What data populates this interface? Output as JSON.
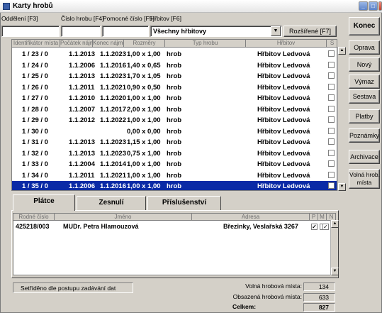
{
  "window": {
    "title": "Karty hrobů"
  },
  "filters": {
    "labels": [
      "Oddělení [F3]",
      "Číslo hrobu [F4]",
      "Pomocné číslo [F5]",
      "Hřbitov [F6]"
    ],
    "cemetery_value": "Všechny hřbitovy",
    "advanced_label": "Rozšířené [F7]"
  },
  "grid": {
    "headers": [
      "Identifikátor místa",
      "Počátek nájmu",
      "Konec nájmu",
      "Rozměry",
      "Typ hrobu",
      "Hřbitov",
      "S"
    ],
    "rows": [
      {
        "id": "1 / 23 / 0",
        "start": "1.1.2013",
        "end": "1.1.2023",
        "size": "1,00 x 1,00",
        "type": "hrob",
        "cemetery": "Hřbitov Ledvová"
      },
      {
        "id": "1 / 24 / 0",
        "start": "1.1.2006",
        "end": "1.1.2016",
        "size": "1,40 x 0,65",
        "type": "hrob",
        "cemetery": "Hřbitov Ledvová"
      },
      {
        "id": "1 / 25 / 0",
        "start": "1.1.2013",
        "end": "1.1.2023",
        "size": "1,70 x 1,05",
        "type": "hrob",
        "cemetery": "Hřbitov Ledvová"
      },
      {
        "id": "1 / 26 / 0",
        "start": "1.1.2011",
        "end": "1.1.2021",
        "size": "0,90 x 0,50",
        "type": "hrob",
        "cemetery": "Hřbitov Ledvová"
      },
      {
        "id": "1 / 27 / 0",
        "start": "1.1.2010",
        "end": "1.1.2020",
        "size": "1,00 x 1,00",
        "type": "hrob",
        "cemetery": "Hřbitov Ledvová"
      },
      {
        "id": "1 / 28 / 0",
        "start": "1.1.2007",
        "end": "1.1.2017",
        "size": "2,00 x 1,00",
        "type": "hrob",
        "cemetery": "Hřbitov Ledvová"
      },
      {
        "id": "1 / 29 / 0",
        "start": "1.1.2012",
        "end": "1.1.2022",
        "size": "1,00 x 1,00",
        "type": "hrob",
        "cemetery": "Hřbitov Ledvová"
      },
      {
        "id": "1 / 30 / 0",
        "start": "",
        "end": "",
        "size": "0,00 x 0,00",
        "type": "hrob",
        "cemetery": "Hřbitov Ledvová"
      },
      {
        "id": "1 / 31 / 0",
        "start": "1.1.2013",
        "end": "1.1.2023",
        "size": "1,15 x 1,00",
        "type": "hrob",
        "cemetery": "Hřbitov Ledvová"
      },
      {
        "id": "1 / 32 / 0",
        "start": "1.1.2013",
        "end": "1.1.2023",
        "size": "0,75 x 1,00",
        "type": "hrob",
        "cemetery": "Hřbitov Ledvová"
      },
      {
        "id": "1 / 33 / 0",
        "start": "1.1.2004",
        "end": "1.1.2014",
        "size": "1,00 x 1,00",
        "type": "hrob",
        "cemetery": "Hřbitov Ledvová"
      },
      {
        "id": "1 / 34 / 0",
        "start": "1.1.2011",
        "end": "1.1.2021",
        "size": "1,00 x 1,00",
        "type": "hrob",
        "cemetery": "Hřbitov Ledvová"
      },
      {
        "id": "1 / 35 / 0",
        "start": "1.1.2006",
        "end": "1.1.2016",
        "size": "1,00 x 1,00",
        "type": "hrob",
        "cemetery": "Hřbitov Ledvová"
      }
    ]
  },
  "actions": {
    "konec": "Konec",
    "oprava": "Oprava",
    "novy": "Nový",
    "vymaz": "Výmaz",
    "sestava": "Sestava",
    "platby": "Platby",
    "poznamky": "Poznámky",
    "archivace": "Archivace",
    "volna_line1": "Volná hrob.",
    "volna_line2": "místa"
  },
  "tabs": [
    "Plátce",
    "Zesnulí",
    "Příslušenství"
  ],
  "payer": {
    "headers": [
      "Rodné číslo",
      "Jméno",
      "Adresa",
      "P",
      "M",
      "N"
    ],
    "rows": [
      {
        "rc": "425218/003",
        "name": "MUDr. Petra Hlamouzová",
        "address": "Březinky, Veslařská  3267"
      }
    ]
  },
  "status": {
    "sort_text": "Setříděno dle postupu zadávání dat",
    "free_label": "Volná hrobová místa:",
    "free_value": "134",
    "occupied_label": "Obsazená hrobová místa:",
    "occupied_value": "633",
    "total_label": "Celkem:",
    "total_value": "827"
  }
}
